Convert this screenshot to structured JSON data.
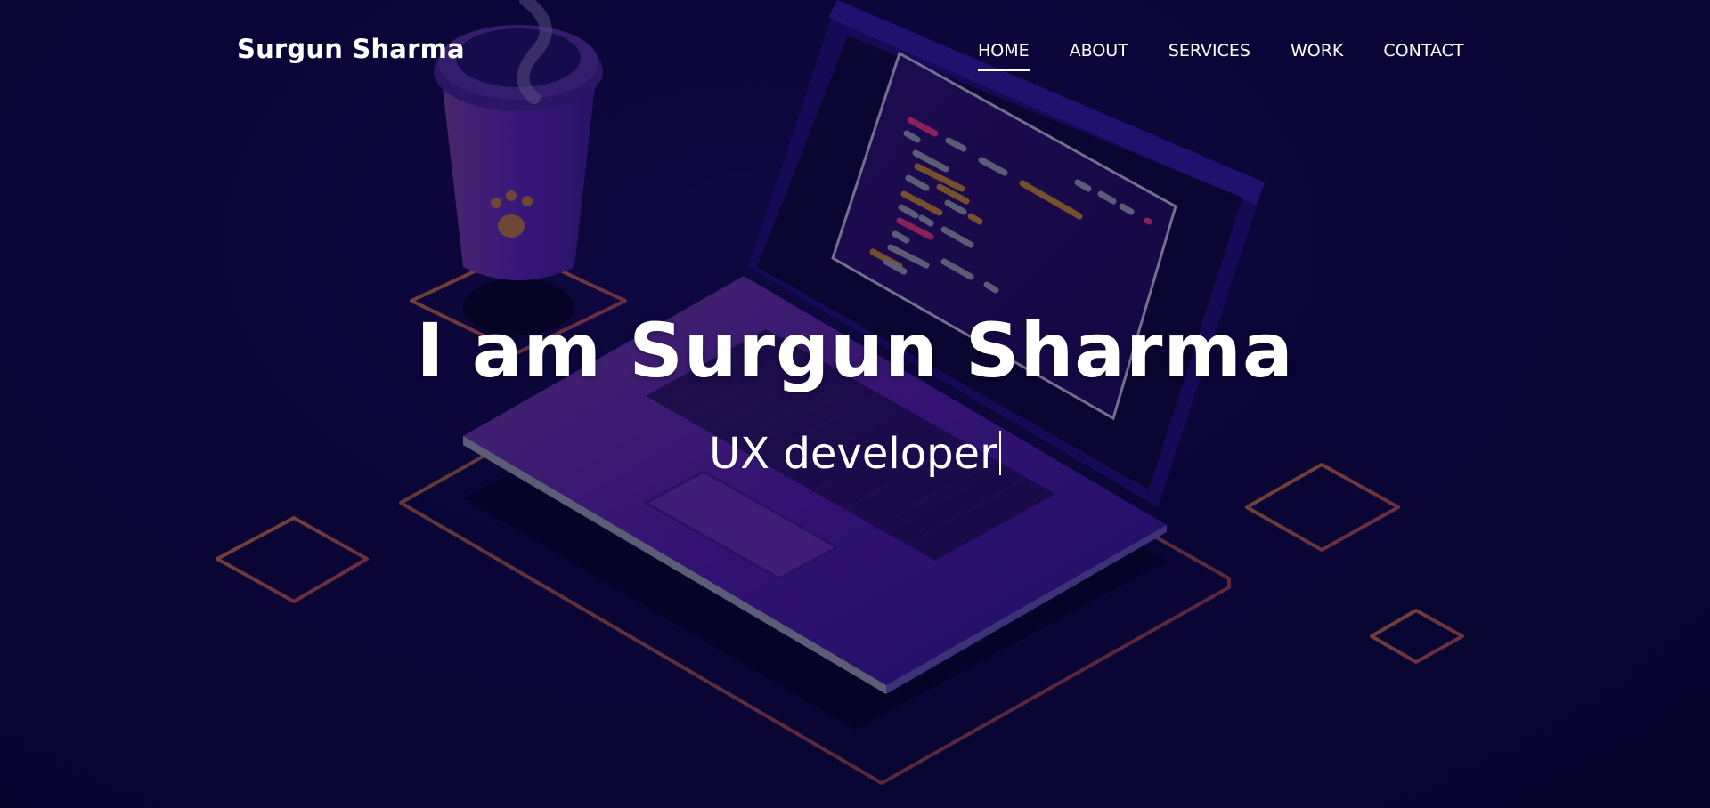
{
  "header": {
    "brand": "Surgun Sharma",
    "nav": [
      {
        "label": "HOME",
        "active": true
      },
      {
        "label": "ABOUT",
        "active": false
      },
      {
        "label": "SERVICES",
        "active": false
      },
      {
        "label": "WORK",
        "active": false
      },
      {
        "label": "CONTACT",
        "active": false
      }
    ]
  },
  "hero": {
    "title": "I am Surgun Sharma",
    "subtitle": "UX developer"
  },
  "colors": {
    "background": "#0a0533",
    "accent_purple": "#5b1fb0",
    "outline_orange": "#b25a38",
    "text": "#ffffff"
  },
  "icons": {
    "coffee_cup": "coffee-cup-illustration",
    "laptop": "laptop-illustration",
    "paw": "paw-print-icon"
  }
}
